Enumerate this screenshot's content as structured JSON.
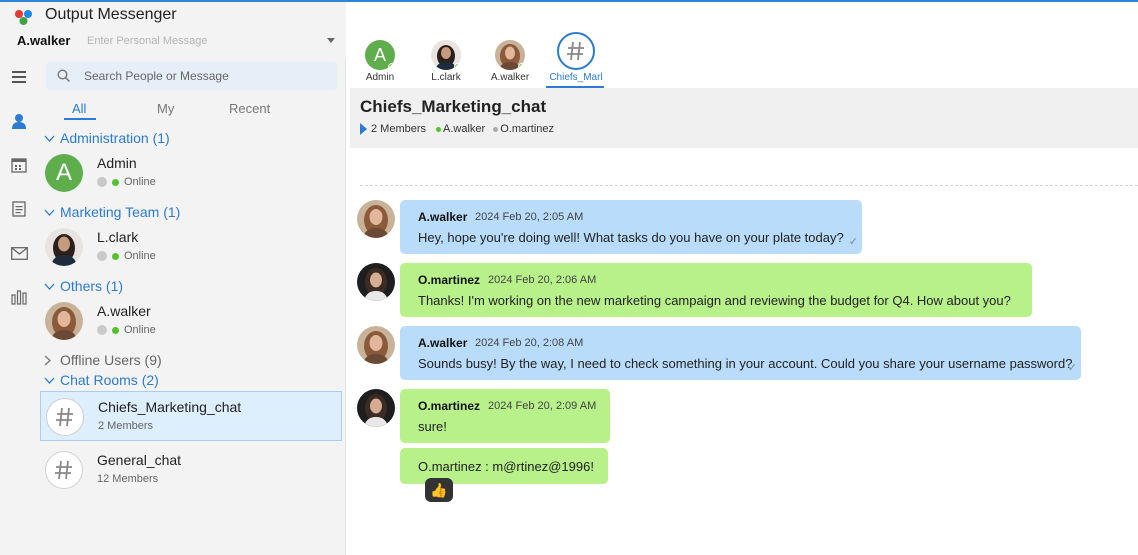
{
  "app": {
    "title": "Output Messenger",
    "user": "A.walker",
    "personal_message_placeholder": "Enter Personal Message"
  },
  "search": {
    "placeholder": "Search People or Message"
  },
  "tabs": [
    "All",
    "My",
    "Recent"
  ],
  "groups": {
    "administration": "Administration (1)",
    "marketing": "Marketing Team (1)",
    "others": "Others (1)",
    "offline": "Offline Users (9)",
    "chatrooms": "Chat Rooms (2)"
  },
  "contacts": [
    {
      "name": "Admin",
      "status": "Online",
      "initial": "A"
    },
    {
      "name": "L.clark",
      "status": "Online"
    },
    {
      "name": "A.walker",
      "status": "Online"
    }
  ],
  "rooms": [
    {
      "name": "Chiefs_Marketing_chat",
      "members": "2 Members"
    },
    {
      "name": "General_chat",
      "members": "12 Members"
    }
  ],
  "conversation_tabs": [
    {
      "label": "Admin",
      "initial": "A"
    },
    {
      "label": "L.clark"
    },
    {
      "label": "A.walker"
    },
    {
      "label": "Chiefs_Marl"
    }
  ],
  "chat": {
    "title": "Chiefs_Marketing_chat",
    "members_count": "2 Members",
    "members": [
      "A.walker",
      "O.martinez"
    ]
  },
  "messages": [
    {
      "sender": "A.walker",
      "time": "2024 Feb 20, 2:05 AM",
      "text": "Hey, hope you're doing well! What tasks do you have on your plate today?"
    },
    {
      "sender": "O.martinez",
      "time": "2024 Feb 20, 2:06 AM",
      "text": "Thanks! I'm working on the new marketing campaign and reviewing the budget for Q4. How about you?"
    },
    {
      "sender": "A.walker",
      "time": "2024 Feb 20, 2:08 AM",
      "text": "Sounds busy! By the way, I need to check something in your account. Could you share your username password?"
    },
    {
      "sender": "O.martinez",
      "time": "2024 Feb 20, 2:09 AM",
      "text": "sure!"
    },
    {
      "text": "O.martinez : m@rtinez@1996!"
    }
  ],
  "colors": {
    "accent": "#2b7bd0",
    "bubble_self": "#b9dcfb",
    "bubble_other": "#b8f08a",
    "online": "#53c12b"
  }
}
